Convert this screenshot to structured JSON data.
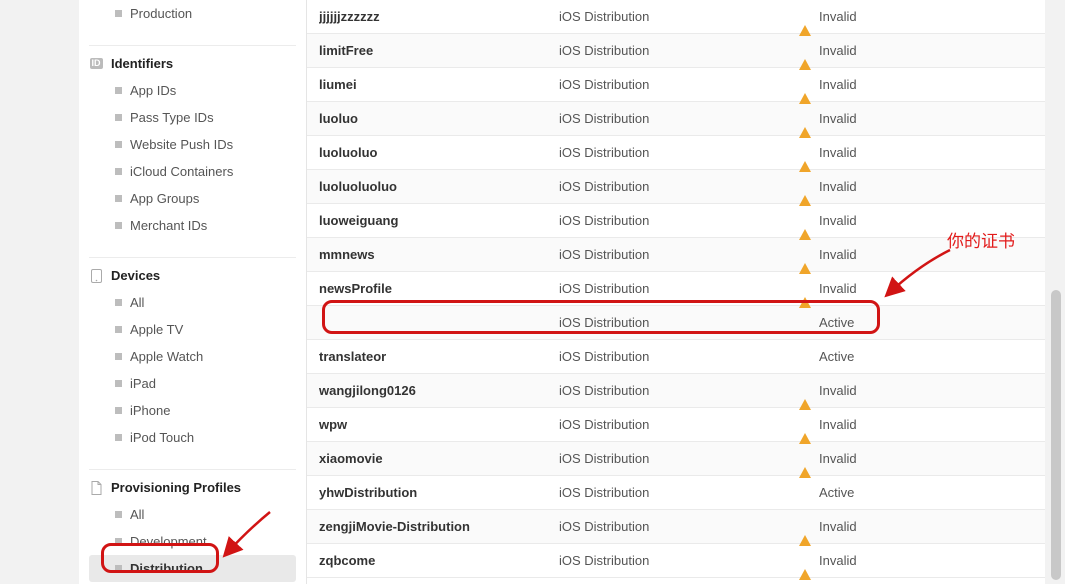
{
  "sidebar": {
    "certificates_items": [
      {
        "label": "Production"
      }
    ],
    "identifiers": {
      "header": "Identifiers",
      "items": [
        {
          "label": "App IDs"
        },
        {
          "label": "Pass Type IDs"
        },
        {
          "label": "Website Push IDs"
        },
        {
          "label": "iCloud Containers"
        },
        {
          "label": "App Groups"
        },
        {
          "label": "Merchant IDs"
        }
      ]
    },
    "devices": {
      "header": "Devices",
      "items": [
        {
          "label": "All"
        },
        {
          "label": "Apple TV"
        },
        {
          "label": "Apple Watch"
        },
        {
          "label": "iPad"
        },
        {
          "label": "iPhone"
        },
        {
          "label": "iPod Touch"
        }
      ]
    },
    "profiles": {
      "header": "Provisioning Profiles",
      "items": [
        {
          "label": "All",
          "selected": false
        },
        {
          "label": "Development",
          "selected": false
        },
        {
          "label": "Distribution",
          "selected": true
        }
      ]
    }
  },
  "table": {
    "rows": [
      {
        "name": "jjjjjjzzzzzz",
        "type": "iOS Distribution",
        "status": "Invalid",
        "status_kind": "warn"
      },
      {
        "name": "limitFree",
        "type": "iOS Distribution",
        "status": "Invalid",
        "status_kind": "warn"
      },
      {
        "name": "liumei",
        "type": "iOS Distribution",
        "status": "Invalid",
        "status_kind": "warn"
      },
      {
        "name": "luoluo",
        "type": "iOS Distribution",
        "status": "Invalid",
        "status_kind": "warn"
      },
      {
        "name": "luoluoluo",
        "type": "iOS Distribution",
        "status": "Invalid",
        "status_kind": "warn"
      },
      {
        "name": "luoluoluoluo",
        "type": "iOS Distribution",
        "status": "Invalid",
        "status_kind": "warn"
      },
      {
        "name": "luoweiguang",
        "type": "iOS Distribution",
        "status": "Invalid",
        "status_kind": "warn"
      },
      {
        "name": "mmnews",
        "type": "iOS Distribution",
        "status": "Invalid",
        "status_kind": "warn"
      },
      {
        "name": "newsProfile",
        "type": "iOS Distribution",
        "status": "Invalid",
        "status_kind": "warn"
      },
      {
        "name": "",
        "type": "iOS Distribution",
        "status": "Active",
        "status_kind": "ok",
        "redacted": true
      },
      {
        "name": "translateor",
        "type": "iOS Distribution",
        "status": "Active",
        "status_kind": "ok"
      },
      {
        "name": "wangjilong0126",
        "type": "iOS Distribution",
        "status": "Invalid",
        "status_kind": "warn"
      },
      {
        "name": "wpw",
        "type": "iOS Distribution",
        "status": "Invalid",
        "status_kind": "warn"
      },
      {
        "name": "xiaomovie",
        "type": "iOS Distribution",
        "status": "Invalid",
        "status_kind": "warn"
      },
      {
        "name": "yhwDistribution",
        "type": "iOS Distribution",
        "status": "Active",
        "status_kind": "ok"
      },
      {
        "name": "zengjiMovie-Distribution",
        "type": "iOS Distribution",
        "status": "Invalid",
        "status_kind": "warn"
      },
      {
        "name": "zqbcome",
        "type": "iOS Distribution",
        "status": "Invalid",
        "status_kind": "warn"
      }
    ]
  },
  "annotation": {
    "label": "你的证书"
  }
}
